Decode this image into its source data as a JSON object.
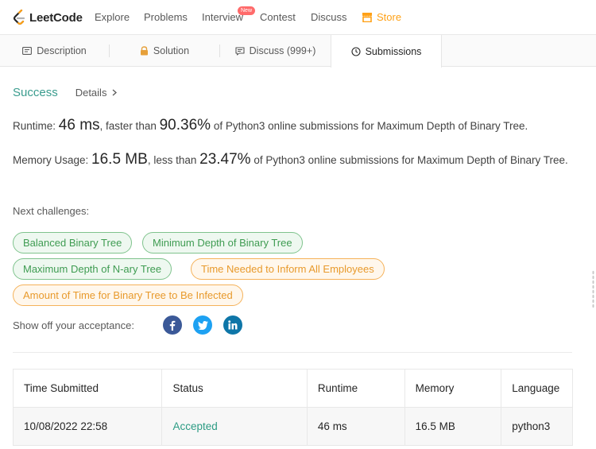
{
  "nav": {
    "logo_text": "LeetCode",
    "items": [
      "Explore",
      "Problems",
      "Interview",
      "Contest",
      "Discuss"
    ],
    "badge": "New",
    "store": "Store"
  },
  "tabs": [
    {
      "label": "Description",
      "icon": "description-icon"
    },
    {
      "label": "Solution",
      "icon": "lock-icon"
    },
    {
      "label": "Discuss (999+)",
      "icon": "comment-icon"
    },
    {
      "label": "Submissions",
      "icon": "clock-icon"
    }
  ],
  "result": {
    "status": "Success",
    "details": "Details",
    "runtime_label": "Runtime:",
    "runtime_value": "46 ms",
    "runtime_mid": ", faster than",
    "runtime_pct": "90.36%",
    "runtime_tail": "of Python3 online submissions for Maximum Depth of Binary Tree.",
    "memory_label": "Memory Usage:",
    "memory_value": "16.5 MB",
    "memory_mid": ", less than",
    "memory_pct": "23.47%",
    "memory_tail": "of Python3 online submissions for Maximum Depth of Binary Tree."
  },
  "next": {
    "label": "Next challenges:",
    "chips": [
      {
        "label": "Balanced Binary Tree",
        "difficulty": "easy"
      },
      {
        "label": "Minimum Depth of Binary Tree",
        "difficulty": "easy"
      },
      {
        "label": "Maximum Depth of N-ary Tree",
        "difficulty": "easy"
      },
      {
        "label": "Time Needed to Inform All Employees",
        "difficulty": "medium"
      },
      {
        "label": "Amount of Time for Binary Tree to Be Infected",
        "difficulty": "medium"
      }
    ]
  },
  "share": {
    "label": "Show off your acceptance:",
    "icons": [
      "facebook-icon",
      "twitter-icon",
      "linkedin-icon"
    ]
  },
  "table": {
    "headers": [
      "Time Submitted",
      "Status",
      "Runtime",
      "Memory",
      "Language"
    ],
    "rows": [
      [
        "10/08/2022 22:58",
        "Accepted",
        "46 ms",
        "16.5 MB",
        "python3"
      ]
    ]
  },
  "colors": {
    "success": "#3a9c8e",
    "easy_chip": "#3f9c52",
    "medium_chip": "#e89a2c",
    "store": "#ffa116",
    "badge": "#ff6b6b"
  }
}
